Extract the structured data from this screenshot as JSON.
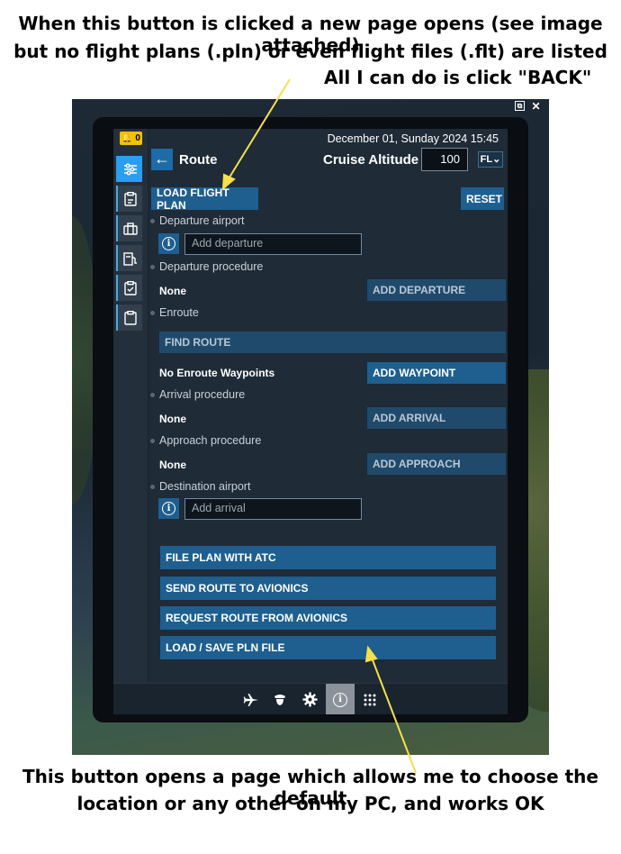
{
  "captions": {
    "top_line1": "When this button is clicked a new page opens (see image attached)",
    "top_line2": "but no flight plans (.pln) or even flight files (.flt) are listed",
    "top_line3": "All I can do is click \"BACK\"",
    "bottom_line1": "This button opens a page which allows me to choose the default",
    "bottom_line2": "location or any other on my PC, and works OK"
  },
  "window_tools": {
    "popout": "⧉",
    "close": "✕"
  },
  "notifications": {
    "count": "0"
  },
  "header": {
    "datetime": "December 01, Sunday 2024 15:45",
    "title": "Route",
    "cruise_label": "Cruise Altitude",
    "cruise_value": "100",
    "unit": "FL"
  },
  "actions": {
    "load_flight_plan": "LOAD FLIGHT PLAN",
    "reset": "RESET"
  },
  "route": {
    "departure_airport_label": "Departure airport",
    "departure_placeholder": "Add departure",
    "departure_procedure_label": "Departure procedure",
    "departure_procedure_value": "None",
    "add_departure": "ADD DEPARTURE",
    "enroute_label": "Enroute",
    "find_route": "FIND ROUTE",
    "enroute_value": "No Enroute Waypoints",
    "add_waypoint": "ADD WAYPOINT",
    "arrival_procedure_label": "Arrival procedure",
    "arrival_procedure_value": "None",
    "add_arrival": "ADD ARRIVAL",
    "approach_procedure_label": "Approach procedure",
    "approach_procedure_value": "None",
    "add_approach": "ADD APPROACH",
    "destination_airport_label": "Destination airport",
    "destination_placeholder": "Add arrival"
  },
  "footer_actions": {
    "file_plan": "FILE PLAN WITH ATC",
    "send_route": "SEND ROUTE TO AVIONICS",
    "request_route": "REQUEST ROUTE FROM AVIONICS",
    "load_save": "LOAD / SAVE PLN FILE"
  },
  "sidebar_icons": [
    "sliders-icon",
    "checklist-icon",
    "briefcase-icon",
    "fuel-icon",
    "clipboard-check-icon",
    "clipboard-icon"
  ],
  "bottom_icons": [
    "airplane-icon",
    "pilot-icon",
    "gear-icon",
    "info-icon",
    "apps-grid-icon"
  ],
  "colors": {
    "accent": "#1e5f8f",
    "active_tab": "#2a9ef0",
    "notification": "#f2c200",
    "arrow": "#f5e04a"
  }
}
